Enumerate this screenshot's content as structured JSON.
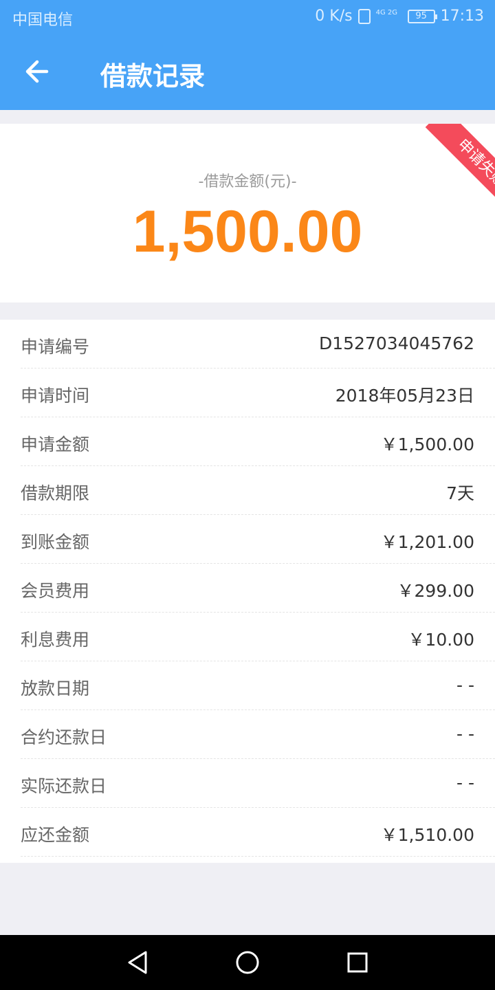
{
  "status_bar": {
    "carrier": "中国电信",
    "network_speed": "0 K/s",
    "signal_label": "4G 2G",
    "battery": "95",
    "time": "17:13"
  },
  "app_bar": {
    "title": "借款记录",
    "back_icon": "arrow-left-icon"
  },
  "summary": {
    "amount_label": "-借款金额(元)-",
    "amount": "1,500.00",
    "status_ribbon": "申请失败"
  },
  "details": [
    {
      "label": "申请编号",
      "value": "D1527034045762"
    },
    {
      "label": "申请时间",
      "value": "2018年05月23日"
    },
    {
      "label": "申请金额",
      "value": "￥1,500.00"
    },
    {
      "label": "借款期限",
      "value": "7天"
    },
    {
      "label": "到账金额",
      "value": "￥1,201.00"
    },
    {
      "label": "会员费用",
      "value": "￥299.00"
    },
    {
      "label": "利息费用",
      "value": "￥10.00"
    },
    {
      "label": "放款日期",
      "value": "- -"
    },
    {
      "label": "合约还款日",
      "value": "- -"
    },
    {
      "label": "实际还款日",
      "value": "- -"
    },
    {
      "label": "应还金额",
      "value": "￥1,510.00"
    }
  ],
  "colors": {
    "primary": "#47a3f7",
    "amount": "#fb8718",
    "ribbon": "#f44b5b"
  }
}
